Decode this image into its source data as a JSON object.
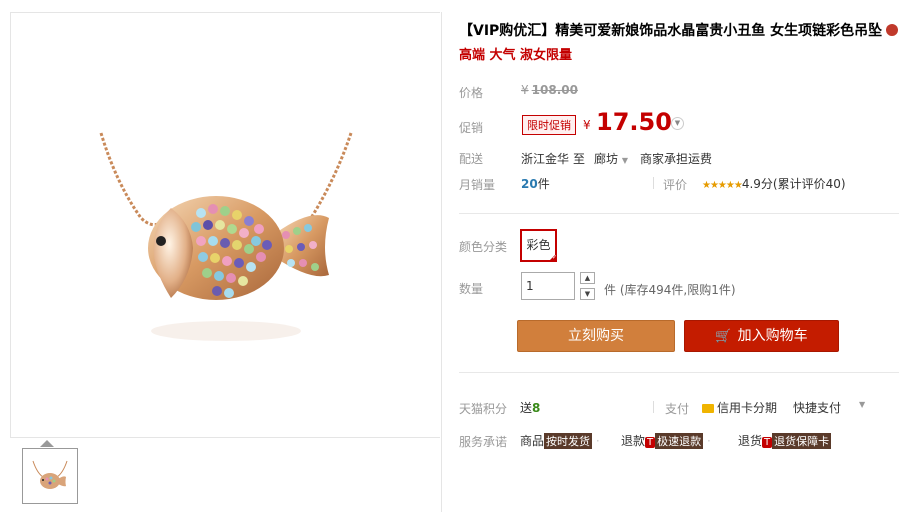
{
  "title": "【VIP购优汇】精美可爱新娘饰品水晶富贵小丑鱼 女生项链彩色吊坠",
  "subtitle": "高端 大气 淑女限量",
  "price": {
    "label": "价格",
    "currency": "¥",
    "value": "108.00"
  },
  "promo": {
    "label": "促销",
    "tag": "限时促销",
    "currency": "¥",
    "value": "17.50"
  },
  "shipping": {
    "label": "配送",
    "from": "浙江金华",
    "to_word": "至",
    "to": "廊坊",
    "note": "商家承担运费"
  },
  "sales": {
    "label": "月销量",
    "count": "20",
    "unit": "件",
    "rating_label": "评价",
    "stars": "★★★★★",
    "rating_text": "4.9分(累计评价40)"
  },
  "options": {
    "color_label": "颜色分类",
    "color_value": "彩色",
    "qty_label": "数量",
    "qty_value": "1",
    "qty_note": "件 (库存494件,限购1件)"
  },
  "buttons": {
    "buy": "立刻购买",
    "cart": "加入购物车"
  },
  "points": {
    "label": "天猫积分",
    "prefix": "送",
    "value": "8"
  },
  "payment": {
    "label": "支付",
    "credit": "信用卡分期",
    "quick": "快捷支付"
  },
  "service": {
    "label": "服务承诺",
    "item1_label": "商品",
    "item1_tag": "按时发货",
    "item2_label": "退款",
    "item2_t": "T",
    "item2_tag": "极速退款",
    "item3_label": "退货",
    "item3_t": "T",
    "item3_tag": "退货保障卡"
  },
  "icons": [
    "fish-necklace-image",
    "thumbnail-image",
    "dropdown-caret-icon",
    "cart-icon",
    "credit-card-icon",
    "check-corner-icon",
    "seal-icon"
  ],
  "colors": {
    "accent": "#c40000",
    "buy": "#d17f3c",
    "cart": "#c41c00"
  }
}
